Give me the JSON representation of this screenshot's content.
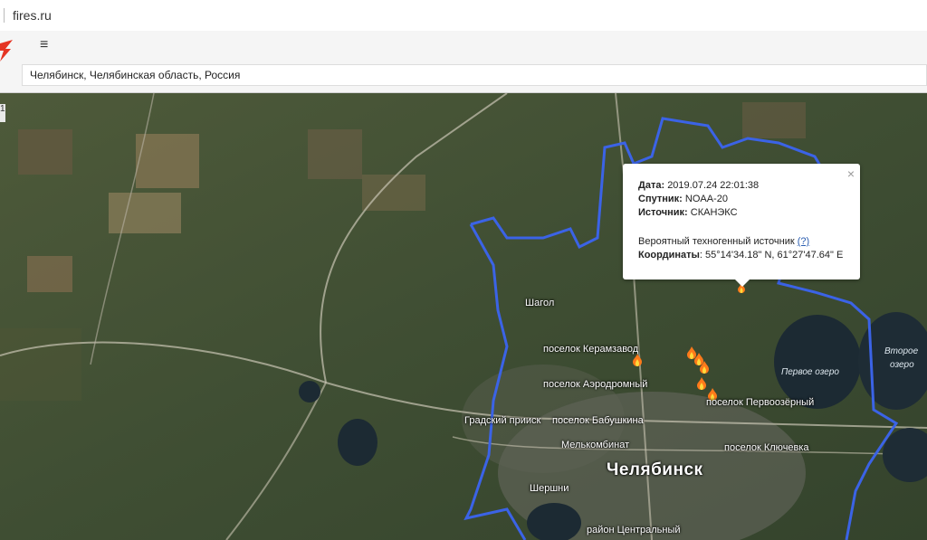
{
  "browser": {
    "url": "fires.ru"
  },
  "header": {
    "menu_icon": "hamburger-icon",
    "search_value": "Челябинск, Челябинская область, Россия"
  },
  "map": {
    "labels": {
      "shagol": "Шагол",
      "keramzavod": "поселок Керамзавод",
      "aerodromny": "поселок Аэродромный",
      "gradsky": "Градский прииск",
      "babushkina": "поселок Бабушкина",
      "melkombinat": "Мелькомбинат",
      "shershni": "Шершни",
      "chelyabinsk": "Челябинск",
      "central": "район Центральный",
      "pervoozerny": "поселок Первоозёрный",
      "klyuchevka": "поселок Ключевка",
      "lake1": "Первое озеро",
      "lake2a": "Второе",
      "lake2b": "озеро"
    },
    "boundary_color": "#3b63e6",
    "fire_icon": "fire-icon",
    "zoom_label": "1"
  },
  "popup": {
    "date_label": "Дата:",
    "date_value": "2019.07.24 22:01:38",
    "satellite_label": "Спутник:",
    "satellite_value": "NOAA-20",
    "source_label": "Источник:",
    "source_value": "СКАНЭКС",
    "probable_text": "Вероятный техногенный источник",
    "help_link": "(?)",
    "coords_label": "Координаты",
    "coords_value": ": 55°14'34.18\" N, 61°27'47.64\" E",
    "close": "×"
  }
}
